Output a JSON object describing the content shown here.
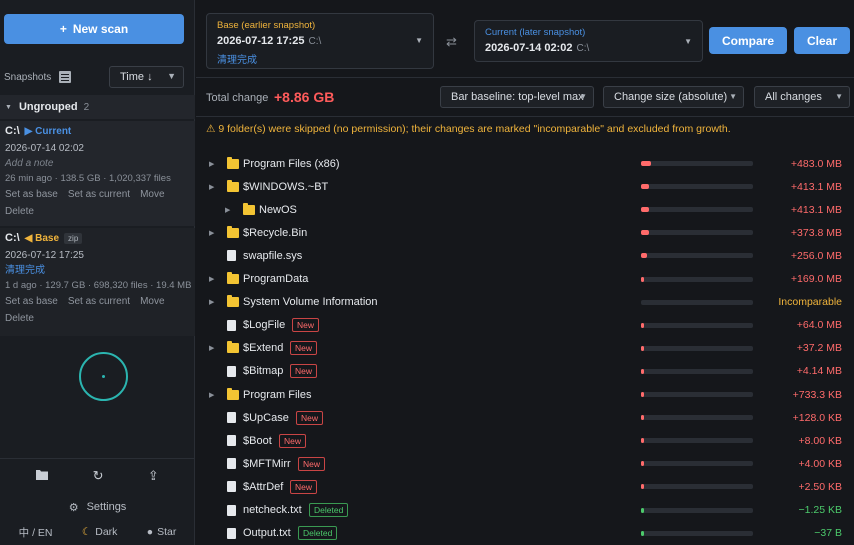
{
  "sidebar": {
    "new_scan": "New scan",
    "snapshots_label": "Snapshots",
    "sort_select": "Time ↓",
    "group": {
      "name": "Ungrouped",
      "count": "2"
    },
    "cards": [
      {
        "drive": "C:\\",
        "badge": "▶ Current",
        "date": "2026-07-14 02:02",
        "note": "Add a note",
        "meta": "26 min ago · 138.5 GB · 1,020,337 files",
        "actions": [
          "Set as base",
          "Set as current",
          "Move"
        ],
        "delete": "Delete"
      },
      {
        "drive": "C:\\",
        "badge": "◀ Base",
        "tag": "zip",
        "date": "2026-07-12 17:25",
        "note": "清理完成",
        "meta": "1 d ago · 129.7 GB · 698,320 files · 19.4 MB",
        "actions": [
          "Set as base",
          "Set as current",
          "Move"
        ],
        "delete": "Delete"
      }
    ],
    "settings": "Settings",
    "lang": "中 / EN",
    "theme": "Dark",
    "star": "Star"
  },
  "header": {
    "base_label": "Base (earlier snapshot)",
    "base_date": "2026-07-12 17:25",
    "base_drive": "C:\\",
    "base_note": "清理完成",
    "cur_label": "Current (later snapshot)",
    "cur_date": "2026-07-14 02:02",
    "cur_drive": "C:\\",
    "compare": "Compare",
    "clear": "Clear"
  },
  "summary": {
    "total_label": "Total change",
    "total_value": "+8.86 GB",
    "bar_baseline": "Bar baseline: top-level max",
    "sort_mode": "Change size (absolute)",
    "filter": "All changes"
  },
  "warning": "⚠ 9 folder(s) were skipped (no permission); their changes are marked \"incomparable\" and excluded from growth.",
  "rows": [
    {
      "name": "Program Files (x86)",
      "type": "folder",
      "depth": 0,
      "exp": true,
      "tag": "",
      "change": "+483.0 MB",
      "kind": "pos",
      "bar": 0.09
    },
    {
      "name": "$WINDOWS.~BT",
      "type": "folder",
      "depth": 0,
      "exp": true,
      "tag": "",
      "change": "+413.1 MB",
      "kind": "pos",
      "bar": 0.07
    },
    {
      "name": "NewOS",
      "type": "folder",
      "depth": 1,
      "exp": true,
      "tag": "",
      "change": "+413.1 MB",
      "kind": "pos",
      "bar": 0.07
    },
    {
      "name": "$Recycle.Bin",
      "type": "folder",
      "depth": 0,
      "exp": true,
      "tag": "",
      "change": "+373.8 MB",
      "kind": "pos",
      "bar": 0.07
    },
    {
      "name": "swapfile.sys",
      "type": "file",
      "depth": 0,
      "exp": false,
      "tag": "",
      "change": "+256.0 MB",
      "kind": "pos",
      "bar": 0.05
    },
    {
      "name": "ProgramData",
      "type": "folder",
      "depth": 0,
      "exp": true,
      "tag": "",
      "change": "+169.0 MB",
      "kind": "pos",
      "bar": 0.03
    },
    {
      "name": "System Volume Information",
      "type": "folder",
      "depth": 0,
      "exp": true,
      "tag": "",
      "change": "Incomparable",
      "kind": "incomp",
      "bar": 0
    },
    {
      "name": "$LogFile",
      "type": "file",
      "depth": 0,
      "exp": false,
      "tag": "New",
      "change": "+64.0 MB",
      "kind": "pos",
      "bar": 0.015
    },
    {
      "name": "$Extend",
      "type": "folder",
      "depth": 0,
      "exp": true,
      "tag": "New",
      "change": "+37.2 MB",
      "kind": "pos",
      "bar": 0.01
    },
    {
      "name": "$Bitmap",
      "type": "file",
      "depth": 0,
      "exp": false,
      "tag": "New",
      "change": "+4.14 MB",
      "kind": "pos",
      "bar": 0.008
    },
    {
      "name": "Program Files",
      "type": "folder",
      "depth": 0,
      "exp": true,
      "tag": "",
      "change": "+733.3 KB",
      "kind": "pos",
      "bar": 0.008
    },
    {
      "name": "$UpCase",
      "type": "file",
      "depth": 0,
      "exp": false,
      "tag": "New",
      "change": "+128.0 KB",
      "kind": "pos",
      "bar": 0.008
    },
    {
      "name": "$Boot",
      "type": "file",
      "depth": 0,
      "exp": false,
      "tag": "New",
      "change": "+8.00 KB",
      "kind": "pos",
      "bar": 0.008
    },
    {
      "name": "$MFTMirr",
      "type": "file",
      "depth": 0,
      "exp": false,
      "tag": "New",
      "change": "+4.00 KB",
      "kind": "pos",
      "bar": 0.008
    },
    {
      "name": "$AttrDef",
      "type": "file",
      "depth": 0,
      "exp": false,
      "tag": "New",
      "change": "+2.50 KB",
      "kind": "pos",
      "bar": 0.008
    },
    {
      "name": "netcheck.txt",
      "type": "file",
      "depth": 0,
      "exp": false,
      "tag": "Deleted",
      "change": "−1.25 KB",
      "kind": "neg",
      "bar": 0.008
    },
    {
      "name": "Output.txt",
      "type": "file",
      "depth": 0,
      "exp": false,
      "tag": "Deleted",
      "change": "−37 B",
      "kind": "neg",
      "bar": 0.008
    }
  ],
  "colors": {
    "accent": "#4a90e2",
    "increase": "#ff6b6b",
    "decrease": "#4cc96b",
    "warning": "#f0b43c",
    "folder": "#f3c433"
  }
}
